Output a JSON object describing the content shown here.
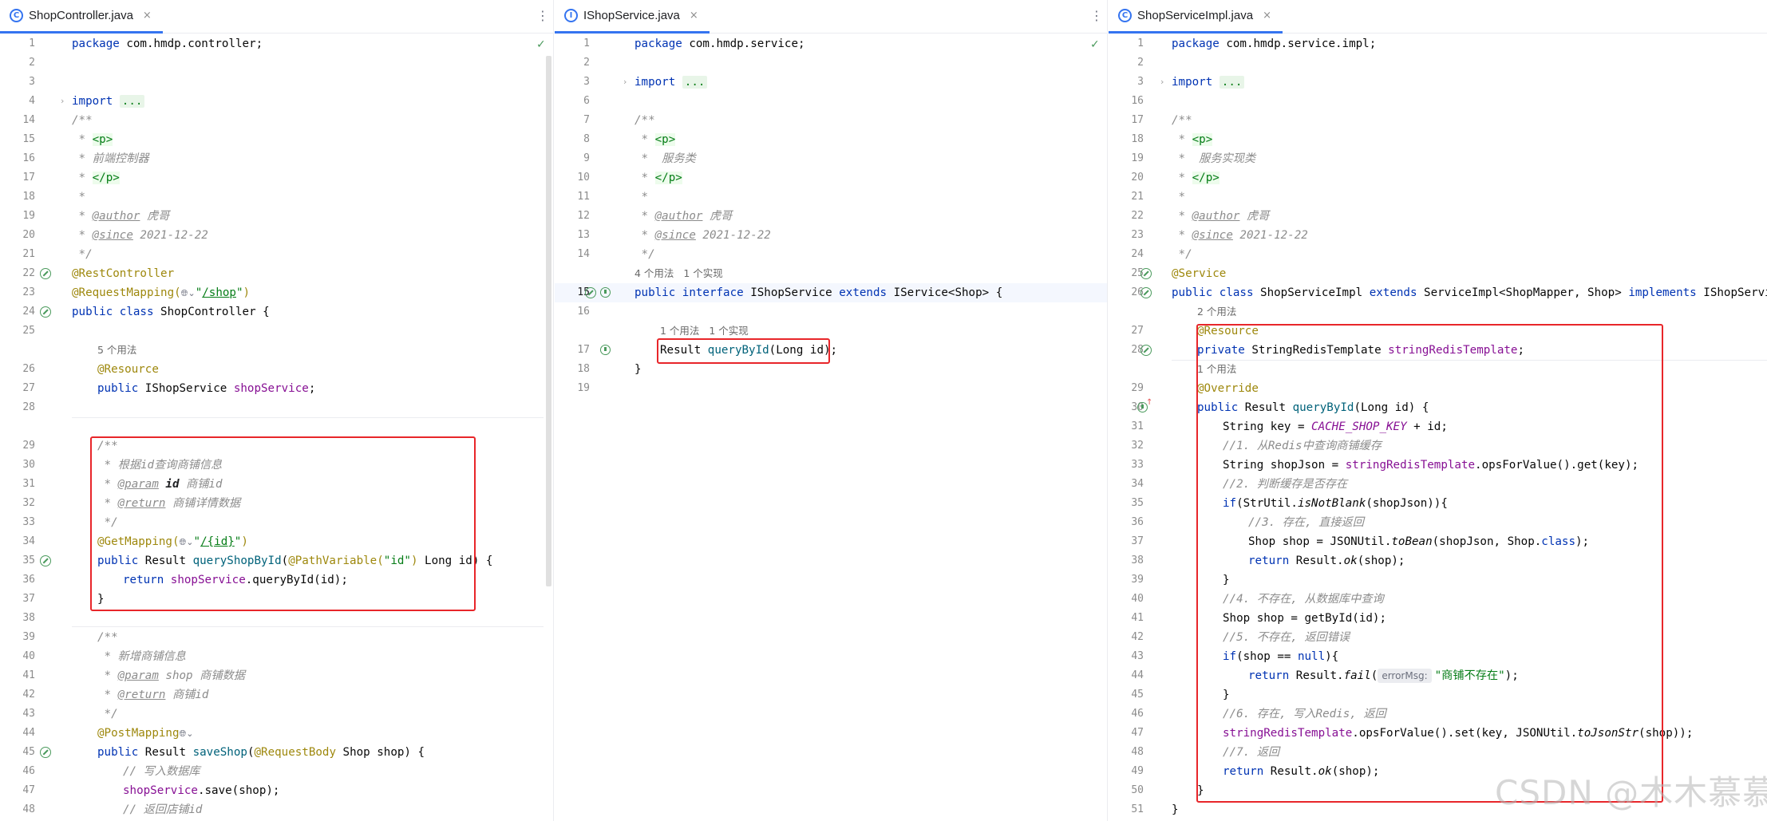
{
  "editors": [
    {
      "tab": {
        "title": "ShopController.java",
        "icon": "class-icon",
        "close": "×"
      },
      "more": "⋮",
      "lines": {
        "l1": "1",
        "l2": "2",
        "l3": "3",
        "l4": "4",
        "l14": "14",
        "l15": "15",
        "l16": "16",
        "l17": "17",
        "l18": "18",
        "l19": "19",
        "l20": "20",
        "l21": "21",
        "l22": "22",
        "l23": "23",
        "l24": "24",
        "l25": "25",
        "l26": "26",
        "l27": "27",
        "l28": "28",
        "l29": "29",
        "l30": "30",
        "l31": "31",
        "l32": "32",
        "l33": "33",
        "l34": "34",
        "l35": "35",
        "l36": "36",
        "l37": "37",
        "l38": "38",
        "l39": "39",
        "l40": "40",
        "l41": "41",
        "l42": "42",
        "l43": "43",
        "l44": "44",
        "l45": "45",
        "l46": "46",
        "l47": "47",
        "l48": "48"
      },
      "code": {
        "package_kw": "package",
        "package_name": " com.hmdp.controller;",
        "import_kw": "import",
        "import_fold": "...",
        "doc_open": "/**",
        "star": " *",
        "p_open": "<p>",
        "desc": " 前端控制器",
        "p_close": "</p>",
        "author_tag": "@author",
        "author_val": " 虎哥",
        "since_tag": "@since",
        "since_val": " 2021-12-22",
        "doc_close": " */",
        "rest_controller": "@RestController",
        "request_mapping": "@RequestMapping(",
        "rm_path_q1": "\"",
        "rm_path": "/shop",
        "rm_path_q2": "\"",
        "rm_close": ")",
        "public_class": "public class",
        "class_name": " ShopController {",
        "hint_5_usages": "5 个用法",
        "resource": "@Resource",
        "public_kw": "public",
        "field_type": " IShopService ",
        "field_name": "shopService",
        "semi": ";",
        "m1_doc_open": "/**",
        "m1_desc": " 根据id查询商铺信息",
        "m1_param_tag": "@param",
        "m1_param_name": " id",
        "m1_param_desc": " 商铺id",
        "m1_return_tag": "@return",
        "m1_return_desc": " 商铺详情数据",
        "m1_doc_close": " */",
        "get_mapping": "@GetMapping(",
        "gm_q1": "\"",
        "gm_path": "/{id}",
        "gm_q2": "\"",
        "gm_close": ")",
        "m1_sig_public": "public",
        "m1_sig_ret": " Result ",
        "m1_sig_name": "queryShopById",
        "m1_sig_paren": "(",
        "m1_pv": "@PathVariable(",
        "m1_pv_val": "\"id\"",
        "m1_pv_close": ")",
        "m1_sig_rest": " Long id) {",
        "m1_return_kw": "return ",
        "m1_return_field": "shopService",
        "m1_return_call": ".queryById(id);",
        "close_brace": "}",
        "m2_doc_open": "/**",
        "m2_desc": " 新增商铺信息",
        "m2_param_tag": "@param",
        "m2_param_name": " shop",
        "m2_param_desc": " 商铺数据",
        "m2_return_tag": "@return",
        "m2_return_desc": " 商铺id",
        "m2_doc_close": " */",
        "post_mapping": "@PostMapping",
        "m2_sig_public": "public",
        "m2_sig_ret": " Result ",
        "m2_sig_name": "saveShop",
        "m2_sig_paren": "(",
        "m2_rb": "@RequestBody",
        "m2_sig_rest": " Shop shop) {",
        "m2_comment1": "// 写入数据库",
        "m2_save_field": "shopService",
        "m2_save_call": ".save(shop);",
        "m2_comment2": "// 返回店铺",
        "m2_comment2_id": "id"
      }
    },
    {
      "tab": {
        "title": "IShopService.java",
        "icon": "interface-icon",
        "close": "×"
      },
      "more": "⋮",
      "lines": {
        "l1": "1",
        "l2": "2",
        "l3": "3",
        "l6": "6",
        "l7": "7",
        "l8": "8",
        "l9": "9",
        "l10": "10",
        "l11": "11",
        "l12": "12",
        "l13": "13",
        "l14": "14",
        "l15": "15",
        "l16": "16",
        "l17": "17",
        "l18": "18",
        "l19": "19"
      },
      "code": {
        "package_kw": "package",
        "package_name": " com.hmdp.service;",
        "import_kw": "import",
        "import_fold": "...",
        "doc_open": "/**",
        "star": " *",
        "p_open": "<p>",
        "desc": "  服务类",
        "p_close": "</p>",
        "author_tag": "@author",
        "author_val": " 虎哥",
        "since_tag": "@since",
        "since_val": " 2021-12-22",
        "doc_close": " */",
        "hint_usages": "4 个用法   1 个实现",
        "public_interface": "public interface",
        "iface_name": " IShopService ",
        "extends_kw": "extends",
        "iface_rest": " IService<Shop> {",
        "hint_method": "1 个用法   1 个实现",
        "method_ret": "Result ",
        "method_name": "queryById",
        "method_rest": "(Long id);",
        "close_brace": "}"
      }
    },
    {
      "tab": {
        "title": "ShopServiceImpl.java",
        "icon": "class-icon",
        "close": "×"
      },
      "lines": {
        "l1": "1",
        "l2": "2",
        "l3": "3",
        "l16": "16",
        "l17": "17",
        "l18": "18",
        "l19": "19",
        "l20": "20",
        "l21": "21",
        "l22": "22",
        "l23": "23",
        "l24": "24",
        "l25": "25",
        "l26": "26",
        "l27": "27",
        "l28": "28",
        "l29": "29",
        "l30": "30",
        "l31": "31",
        "l32": "32",
        "l33": "33",
        "l34": "34",
        "l35": "35",
        "l36": "36",
        "l37": "37",
        "l38": "38",
        "l39": "39",
        "l40": "40",
        "l41": "41",
        "l42": "42",
        "l43": "43",
        "l44": "44",
        "l45": "45",
        "l46": "46",
        "l47": "47",
        "l48": "48",
        "l49": "49",
        "l50": "50",
        "l51": "51"
      },
      "code": {
        "package_kw": "package",
        "package_name": " com.hmdp.service.impl;",
        "import_kw": "import",
        "import_fold": "...",
        "doc_open": "/**",
        "star": " *",
        "p_open": "<p>",
        "desc": "  服务实现类",
        "p_close": "</p>",
        "author_tag": "@author",
        "author_val": " 虎哥",
        "since_tag": "@since",
        "since_val": " 2021-12-22",
        "doc_close": " */",
        "service_ann": "@Service",
        "public_class": "public class",
        "class_name": " ShopServiceImpl ",
        "extends_kw": "extends",
        "class_mid": " ServiceImpl<ShopMapper, Shop> ",
        "implements_kw": "implements",
        "class_rest": " IShopService {",
        "hint_2_usages": "2 个用法",
        "resource": "@Resource",
        "private_kw": "private",
        "field_type": " StringRedisTemplate ",
        "field_name": "stringRedisTemplate",
        "semi": ";",
        "hint_1_usage": "1 个用法",
        "override": "@Override",
        "m_public": "public",
        "m_ret": " Result ",
        "m_name": "queryById",
        "m_rest": "(Long id) {",
        "s31_a": "String key = ",
        "s31_const": "CACHE_SHOP_KEY",
        "s31_b": " + id;",
        "c32": "//1. 从Redis中查询商铺缓存",
        "s33_a": "String shopJson = ",
        "s33_field": "stringRedisTemplate",
        "s33_b": ".opsForValue().get(key);",
        "c34": "//2. 判断缓存是否存在",
        "s35_if": "if",
        "s35_a": "(StrUtil.",
        "s35_m": "isNotBlank",
        "s35_b": "(shopJson)){",
        "c36": "//3. 存在, 直接返回",
        "s37_a": "Shop shop = JSONUtil.",
        "s37_m": "toBean",
        "s37_b": "(shopJson, Shop.",
        "s37_class": "class",
        "s37_c": ");",
        "s38_ret": "return",
        "s38_a": " Result.",
        "s38_m": "ok",
        "s38_b": "(shop);",
        "close_brace": "}",
        "c40": "//4. 不存在, 从数据库中查询",
        "s41": "Shop shop = getById(id);",
        "c42": "//5. 不存在, 返回错误",
        "s43_if": "if",
        "s43_a": "(shop == ",
        "s43_null": "null",
        "s43_b": "){",
        "s44_ret": "return",
        "s44_a": " Result.",
        "s44_m": "fail",
        "s44_b": "(",
        "s44_hint": "errorMsg:",
        "s44_str": "\"商铺不存在\"",
        "s44_c": ");",
        "c46": "//6. 存在, 写入Redis, 返回",
        "s47_field": "stringRedisTemplate",
        "s47_a": ".opsForValue().set(key, JSONUtil.",
        "s47_m": "toJsonStr",
        "s47_b": "(shop));",
        "c48": "//7. 返回",
        "s49_ret": "return",
        "s49_a": " Result.",
        "s49_m": "ok",
        "s49_b": "(shop);"
      }
    }
  ],
  "watermark": "CSDN @木木慕慕"
}
